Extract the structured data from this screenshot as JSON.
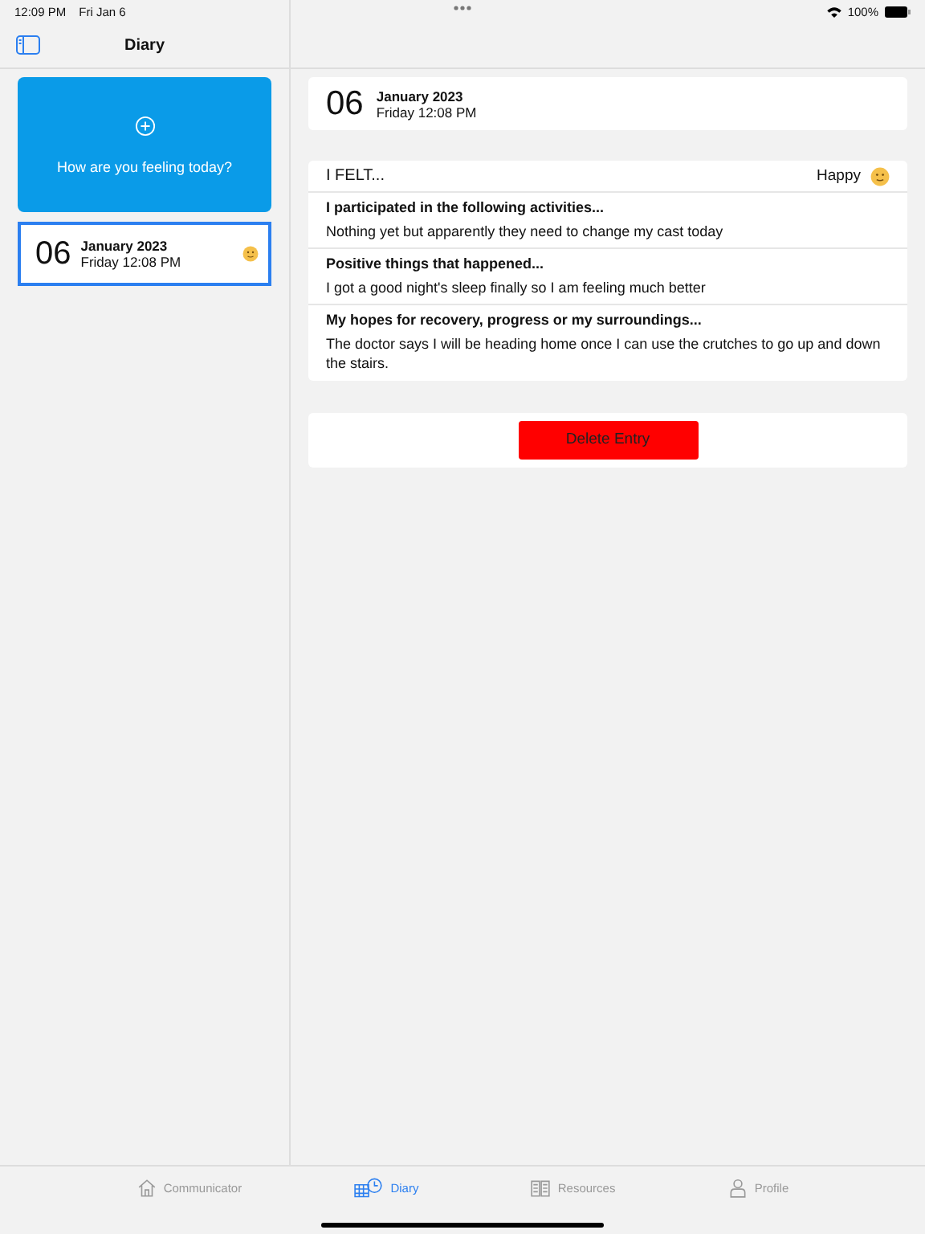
{
  "status_bar": {
    "time": "12:09 PM",
    "date": "Fri Jan 6",
    "battery": "100%"
  },
  "sidebar": {
    "title": "Diary",
    "new_entry_label": "How are you feeling today?",
    "entries": [
      {
        "day": "06",
        "month_year": "January 2023",
        "time": "Friday 12:08 PM",
        "selected": true
      }
    ]
  },
  "detail": {
    "header": {
      "day": "06",
      "month_year": "January 2023",
      "time": "Friday 12:08 PM"
    },
    "felt": {
      "label": "I FELT...",
      "mood": "Happy"
    },
    "sections": [
      {
        "heading": "I participated in the following activities...",
        "text": "Nothing yet but apparently they need to change my cast today"
      },
      {
        "heading": "Positive things that happened...",
        "text": "I got a good night's sleep finally so I am feeling much better"
      },
      {
        "heading": "My hopes for recovery, progress or my surroundings...",
        "text": "The doctor says I will be heading home once I can use the crutches to go up and down the stairs."
      }
    ],
    "delete_button": "Delete Entry"
  },
  "tabs": [
    {
      "kind": "home",
      "label": "Communicator",
      "selected": false
    },
    {
      "kind": "diary",
      "label": "Diary",
      "selected": true
    },
    {
      "kind": "book",
      "label": "Resources",
      "selected": false
    },
    {
      "kind": "person",
      "label": "Profile",
      "selected": false
    }
  ]
}
